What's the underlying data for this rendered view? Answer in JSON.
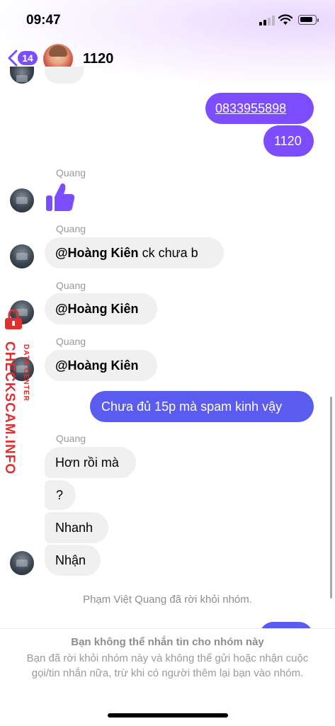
{
  "status_bar": {
    "time": "09:47"
  },
  "header": {
    "back_count": "14",
    "title": "1120"
  },
  "messages": {
    "out_phone": "0833955898",
    "out_1120": "1120",
    "sender": "Quang",
    "in_mention_1": "@Hoàng Kiên",
    "in_mention_1_rest": " ck chưa b",
    "in_mention_2": "@Hoàng Kiên",
    "in_mention_3": "@Hoàng Kiên",
    "out_spam": "Chưa đủ 15p mà spam kinh vậy",
    "in_hon": "Hơn rồi mà",
    "in_q": "?",
    "in_nhanh": "Nhanh",
    "in_nhan": "Nhận"
  },
  "system_message": "Phạm Việt Quang đã rời khỏi nhóm.",
  "footer": {
    "title": "Bạn không thể nhắn tin cho nhóm này",
    "body": "Bạn đã rời khỏi nhóm này và không thể gửi hoặc nhận cuộc gọi/tin nhắn nữa, trừ khi có người thêm lại bạn vào nhóm."
  },
  "watermark": {
    "main": "CHECKSCAM.INFO",
    "sub": "DATA CENTER"
  },
  "colors": {
    "accent_purple": "#7b4dff",
    "accent_blue": "#5a5cf0",
    "incoming_bg": "#f0f0f0"
  },
  "icons": [
    "back-chevron-icon",
    "thumbs-up-icon",
    "signal-icon",
    "wifi-icon",
    "battery-icon",
    "lock-icon"
  ]
}
